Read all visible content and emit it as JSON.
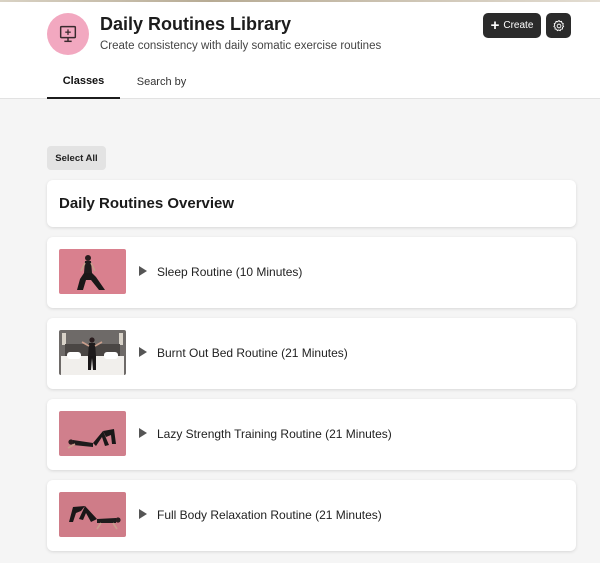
{
  "header": {
    "title": "Daily Routines Library",
    "subtitle": "Create consistency with daily somatic exercise routines",
    "logo_icon": "monitor-icon",
    "create_label": "Create",
    "accent_color": "#f2a8c0"
  },
  "tabs": [
    {
      "label": "Classes",
      "active": true
    },
    {
      "label": "Search by",
      "active": false
    }
  ],
  "select_all_label": "Select All",
  "overview_title": "Daily Routines Overview",
  "routines": [
    {
      "title": "Sleep Routine (10 Minutes)"
    },
    {
      "title": "Burnt Out Bed Routine (21 Minutes)"
    },
    {
      "title": "Lazy Strength Training Routine (21 Minutes)"
    },
    {
      "title": "Full Body Relaxation Routine (21 Minutes)"
    }
  ]
}
